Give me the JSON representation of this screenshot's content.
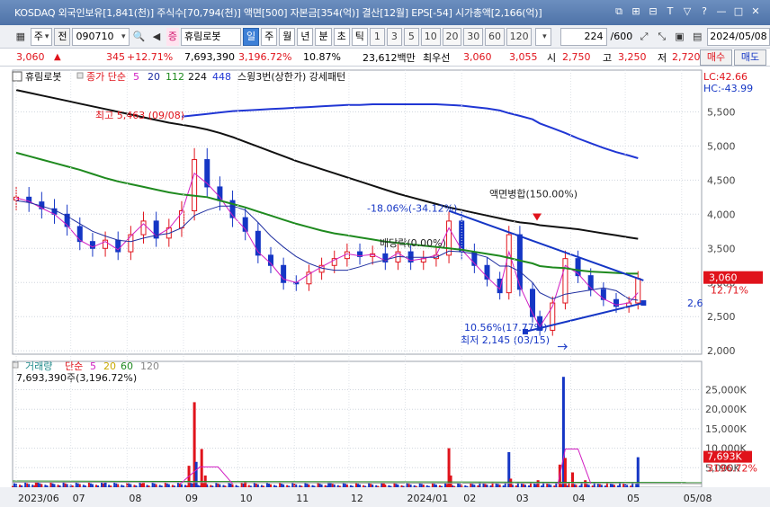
{
  "titlebar": {
    "text": "KOSDAQ 외국인보유[1,841(천)] 주식수[70,794(천)] 액면[500] 자본금[354(억)] 결산[12월] EPS[-54] 시가총액[2,166(억)]",
    "buttons": [
      "⧉",
      "⊞",
      "⊟",
      "T",
      "▽",
      "?",
      "—",
      "□",
      "✕"
    ]
  },
  "toolbar": {
    "type_label": "주",
    "prev_label": "전",
    "code": "090710",
    "badge": "증",
    "name": "휴림로봇",
    "periods": [
      "일",
      "주",
      "월",
      "년",
      "분",
      "초",
      "틱"
    ],
    "selected_period": "일",
    "intervals": [
      "1",
      "3",
      "5",
      "10",
      "20",
      "30",
      "60",
      "120"
    ],
    "count": "224",
    "count_total": "/600",
    "date": "2024/05/08"
  },
  "quote": {
    "price": "3,060",
    "arrow": "▲",
    "change": "345",
    "change_pct": "+12.71%",
    "volume": "7,693,390",
    "volume_ratio": "3,196.72%",
    "turnover": "10.87%",
    "amount": "23,612백만",
    "best_label": "최우선",
    "best_ask": "3,060",
    "best_bid": "3,055",
    "open_label": "시",
    "open": "2,750",
    "high_label": "고",
    "high": "3,250",
    "low_label": "저",
    "low": "2,720",
    "buy_label": "매수",
    "sell_label": "매도"
  },
  "colors": {
    "up": "#e0131b",
    "down": "#1536c5",
    "ma5": "#d11ec2",
    "ma20": "#1e2ea0",
    "ma112": "#1f8a1f",
    "ma224": "#111111",
    "ma448": "#2036d4"
  },
  "chart_data": [
    {
      "type": "candlestick",
      "name": "휴림로봇",
      "legend": {
        "stock": "휴림로봇",
        "ma_label": "종가 단순",
        "ma_periods": [
          "5",
          "20",
          "112",
          "224",
          "448"
        ],
        "pattern": "스윙3번(상한가) 강세패턴"
      },
      "lc": "LC:42.66",
      "hc": "HC:-43.99",
      "yticks": [
        2000,
        2500,
        3000,
        3500,
        4000,
        4500,
        5000,
        5500
      ],
      "ylim": [
        1950,
        5900
      ],
      "last_price": "3,060",
      "last_pct": "12.71%",
      "cut_label": "2,6",
      "annotations": [
        {
          "text": "최고 5,463 (09/08)",
          "value": 5463
        },
        {
          "text": "-18.06%(-34.12%)"
        },
        {
          "text": "액면병합(150.00%)"
        },
        {
          "text": "배당락(0.00%)"
        },
        {
          "text": "10.56%(17.77%)"
        },
        {
          "text": "최저 2,145 (03/15)",
          "value": 2145
        }
      ],
      "close_series": [
        {
          "d": "2023-06-01",
          "c": 4250
        },
        {
          "d": "2023-06-08",
          "c": 4180
        },
        {
          "d": "2023-06-15",
          "c": 4080
        },
        {
          "d": "2023-06-22",
          "c": 4000
        },
        {
          "d": "2023-06-29",
          "c": 3820
        },
        {
          "d": "2023-07-06",
          "c": 3600
        },
        {
          "d": "2023-07-13",
          "c": 3500
        },
        {
          "d": "2023-07-20",
          "c": 3620
        },
        {
          "d": "2023-07-27",
          "c": 3450
        },
        {
          "d": "2023-08-03",
          "c": 3700
        },
        {
          "d": "2023-08-10",
          "c": 3900
        },
        {
          "d": "2023-08-17",
          "c": 3650
        },
        {
          "d": "2023-08-24",
          "c": 3800
        },
        {
          "d": "2023-08-31",
          "c": 4050
        },
        {
          "d": "2023-09-07",
          "c": 4800
        },
        {
          "d": "2023-09-14",
          "c": 4400
        },
        {
          "d": "2023-09-21",
          "c": 4200
        },
        {
          "d": "2023-09-28",
          "c": 3950
        },
        {
          "d": "2023-10-05",
          "c": 3750
        },
        {
          "d": "2023-10-12",
          "c": 3400
        },
        {
          "d": "2023-10-19",
          "c": 3250
        },
        {
          "d": "2023-10-26",
          "c": 3000
        },
        {
          "d": "2023-11-02",
          "c": 2980
        },
        {
          "d": "2023-11-09",
          "c": 3150
        },
        {
          "d": "2023-11-16",
          "c": 3250
        },
        {
          "d": "2023-11-23",
          "c": 3350
        },
        {
          "d": "2023-11-30",
          "c": 3450
        },
        {
          "d": "2023-12-07",
          "c": 3380
        },
        {
          "d": "2023-12-14",
          "c": 3420
        },
        {
          "d": "2023-12-21",
          "c": 3300
        },
        {
          "d": "2023-12-28",
          "c": 3450
        },
        {
          "d": "2024-01-04",
          "c": 3300
        },
        {
          "d": "2024-01-11",
          "c": 3350
        },
        {
          "d": "2024-01-18",
          "c": 3400
        },
        {
          "d": "2024-01-25",
          "c": 3900
        },
        {
          "d": "2024-02-01",
          "c": 3450
        },
        {
          "d": "2024-02-08",
          "c": 3250
        },
        {
          "d": "2024-02-15",
          "c": 3050
        },
        {
          "d": "2024-02-22",
          "c": 2850
        },
        {
          "d": "2024-02-27",
          "c": 3700
        },
        {
          "d": "2024-03-04",
          "c": 2900
        },
        {
          "d": "2024-03-11",
          "c": 2500
        },
        {
          "d": "2024-03-15",
          "c": 2300
        },
        {
          "d": "2024-03-22",
          "c": 2700
        },
        {
          "d": "2024-03-29",
          "c": 3350
        },
        {
          "d": "2024-04-05",
          "c": 3100
        },
        {
          "d": "2024-04-12",
          "c": 2900
        },
        {
          "d": "2024-04-19",
          "c": 2750
        },
        {
          "d": "2024-04-26",
          "c": 2650
        },
        {
          "d": "2024-05-03",
          "c": 2700
        },
        {
          "d": "2024-05-08",
          "c": 3060
        }
      ],
      "ma_series": [
        {
          "name": "5",
          "values": [
            4240,
            4190,
            4090,
            4000,
            3840,
            3620,
            3520,
            3600,
            3480,
            3680,
            3860,
            3680,
            3790,
            4020,
            4600,
            4450,
            4250,
            3980,
            3780,
            3450,
            3280,
            3050,
            3000,
            3120,
            3230,
            3330,
            3420,
            3390,
            3410,
            3320,
            3430,
            3320,
            3350,
            3400,
            3800,
            3480,
            3280,
            3080,
            2900,
            3450,
            2950,
            2550,
            2350,
            2650,
            3250,
            3130,
            2920,
            2760,
            2670,
            2700,
            2850
          ]
        },
        {
          "name": "20",
          "values": [
            4200,
            4170,
            4120,
            4060,
            3970,
            3860,
            3750,
            3680,
            3620,
            3600,
            3650,
            3690,
            3720,
            3800,
            3980,
            4060,
            4120,
            4120,
            4060,
            3880,
            3680,
            3520,
            3380,
            3280,
            3210,
            3180,
            3180,
            3230,
            3290,
            3330,
            3380,
            3370,
            3370,
            3370,
            3460,
            3450,
            3420,
            3370,
            3240,
            3240,
            3160,
            3000,
            2850,
            2760,
            2830,
            2860,
            2890,
            2920,
            2880,
            2760,
            2740
          ]
        },
        {
          "name": "112",
          "values": [
            4900,
            4850,
            4800,
            4750,
            4700,
            4650,
            4590,
            4530,
            4480,
            4440,
            4400,
            4360,
            4320,
            4290,
            4270,
            4250,
            4200,
            4150,
            4100,
            4040,
            3980,
            3920,
            3860,
            3810,
            3760,
            3720,
            3690,
            3660,
            3630,
            3600,
            3580,
            3560,
            3540,
            3520,
            3500,
            3480,
            3450,
            3420,
            3390,
            3360,
            3320,
            3280,
            3240,
            3220,
            3210,
            3180,
            3160,
            3150,
            3140,
            3130,
            3130
          ]
        },
        {
          "name": "224",
          "values": [
            5820,
            5780,
            5740,
            5700,
            5660,
            5620,
            5580,
            5540,
            5500,
            5460,
            5420,
            5380,
            5340,
            5310,
            5280,
            5240,
            5190,
            5130,
            5060,
            4990,
            4920,
            4850,
            4780,
            4720,
            4660,
            4600,
            4540,
            4480,
            4420,
            4360,
            4300,
            4250,
            4200,
            4150,
            4100,
            4060,
            4020,
            3980,
            3940,
            3910,
            3880,
            3860,
            3840,
            3820,
            3800,
            3780,
            3750,
            3720,
            3690,
            3660,
            3640
          ]
        },
        {
          "name": "448",
          "values": [
            null,
            null,
            null,
            null,
            null,
            null,
            null,
            null,
            null,
            null,
            null,
            null,
            null,
            5430,
            5450,
            5470,
            5490,
            5510,
            5520,
            5530,
            5540,
            5550,
            5560,
            5570,
            5580,
            5590,
            5600,
            5600,
            5610,
            5610,
            5610,
            5610,
            5610,
            5610,
            5600,
            5590,
            5570,
            5550,
            5520,
            5480,
            5440,
            5390,
            5330,
            5260,
            5190,
            5110,
            5040,
            4970,
            4910,
            4860,
            4820
          ]
        }
      ],
      "trendlines": [
        {
          "from": {
            "d": "2024-01-25",
            "v": 4050
          },
          "to": {
            "d": "2024-05-11",
            "v": 3030
          },
          "color": "#1536c5"
        },
        {
          "from": {
            "d": "2024-03-07",
            "v": 2280
          },
          "to": {
            "d": "2024-05-11",
            "v": 2700
          },
          "color": "#1536c5"
        }
      ]
    },
    {
      "type": "bar",
      "name": "거래량",
      "legend": {
        "title": "거래량",
        "ma_label": "단순",
        "ma_periods": [
          "5",
          "20",
          "60",
          "120"
        ],
        "value": "7,693,390주(3,196.72%)"
      },
      "yticks_labels": [
        "5,000K",
        "10,000K",
        "15,000K",
        "20,000K",
        "25,000K"
      ],
      "yticks": [
        5000,
        10000,
        15000,
        20000,
        25000
      ],
      "ylim": [
        0,
        29500
      ],
      "unit": "K",
      "last_label": "7,693K",
      "last_pct": "3196.72%",
      "spikes": [
        {
          "d": "2023-06-12",
          "v": 1200
        },
        {
          "d": "2023-07-20",
          "v": 1300
        },
        {
          "d": "2023-08-10",
          "v": 1100
        },
        {
          "d": "2023-09-04",
          "v": 5500
        },
        {
          "d": "2023-09-07",
          "v": 21800
        },
        {
          "d": "2023-09-08",
          "v": 6500
        },
        {
          "d": "2023-09-11",
          "v": 9800
        },
        {
          "d": "2023-09-13",
          "v": 3000
        },
        {
          "d": "2023-10-05",
          "v": 1400
        },
        {
          "d": "2023-11-20",
          "v": 1200
        },
        {
          "d": "2023-12-20",
          "v": 1000
        },
        {
          "d": "2024-01-25",
          "v": 10000
        },
        {
          "d": "2024-01-26",
          "v": 3000
        },
        {
          "d": "2024-02-27",
          "v": 9000
        },
        {
          "d": "2024-02-28",
          "v": 2200
        },
        {
          "d": "2024-03-14",
          "v": 1800
        },
        {
          "d": "2024-03-26",
          "v": 5800
        },
        {
          "d": "2024-03-28",
          "v": 28300
        },
        {
          "d": "2024-03-29",
          "v": 7500
        },
        {
          "d": "2024-04-02",
          "v": 3800
        },
        {
          "d": "2024-04-09",
          "v": 1800
        },
        {
          "d": "2024-05-08",
          "v": 7693
        }
      ]
    }
  ],
  "xaxis": {
    "labels": [
      {
        "d": "2023-06-01",
        "t": "2023/06"
      },
      {
        "d": "2023-07-01",
        "t": "07"
      },
      {
        "d": "2023-08-01",
        "t": "08"
      },
      {
        "d": "2023-09-01",
        "t": "09"
      },
      {
        "d": "2023-10-01",
        "t": "10"
      },
      {
        "d": "2023-11-01",
        "t": "11"
      },
      {
        "d": "2023-12-01",
        "t": "12"
      },
      {
        "d": "2024-01-01",
        "t": "2024/01"
      },
      {
        "d": "2024-02-01",
        "t": "02"
      },
      {
        "d": "2024-03-01",
        "t": "03"
      },
      {
        "d": "2024-04-01",
        "t": "04"
      },
      {
        "d": "2024-05-01",
        "t": "05"
      },
      {
        "d": "2024-06-01",
        "t": "05/08"
      }
    ],
    "range": [
      "2023-05-30",
      "2024-06-12"
    ]
  }
}
